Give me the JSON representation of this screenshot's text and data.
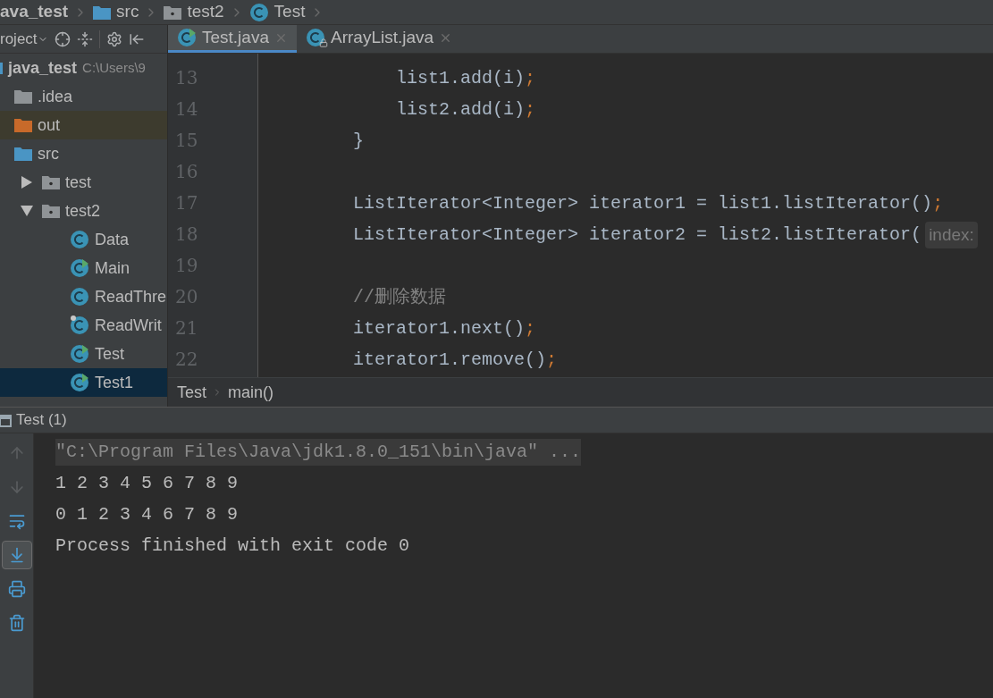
{
  "navigation_bar": [
    {
      "kind": "module",
      "label": "ava_test"
    },
    {
      "kind": "folder",
      "label": "src"
    },
    {
      "kind": "package",
      "label": "test2"
    },
    {
      "kind": "class",
      "label": "Test"
    }
  ],
  "project_toolbar": {
    "label": "roject"
  },
  "project_tree": [
    {
      "kind": "module",
      "label": "java_test",
      "path": "C:\\Users\\9",
      "selected": false,
      "children": [
        {
          "kind": "folder",
          "label": ".idea",
          "color": "#8f9396",
          "excluded": false,
          "selected": false
        },
        {
          "kind": "folder",
          "label": "out",
          "color": "#c86a2a",
          "excluded": true,
          "selected": false
        },
        {
          "kind": "folder",
          "label": "src",
          "color": "#4a95c4",
          "excluded": false,
          "selected": false,
          "children": [
            {
              "kind": "package",
              "label": "test",
              "expanded": false,
              "selected": false
            },
            {
              "kind": "package",
              "label": "test2",
              "expanded": true,
              "selected": false,
              "children": [
                {
                  "kind": "class",
                  "label": "Data",
                  "selected": false
                },
                {
                  "kind": "main_class",
                  "label": "Main",
                  "selected": false
                },
                {
                  "kind": "class",
                  "label": "ReadThre",
                  "selected": false
                },
                {
                  "kind": "marked_class",
                  "label": "ReadWrit",
                  "selected": false
                },
                {
                  "kind": "main_class",
                  "label": "Test",
                  "selected": false
                },
                {
                  "kind": "main_class",
                  "label": "Test1",
                  "selected": true
                }
              ]
            }
          ]
        }
      ]
    }
  ],
  "editor_tabs": [
    {
      "label": "Test.java",
      "selected": true
    },
    {
      "label": "ArrayList.java",
      "selected": false
    }
  ],
  "code_lines": [
    {
      "number": "13",
      "segments": [
        {
          "kind": "code",
          "text": "            list1.add(i)"
        },
        {
          "kind": "keyword",
          "text": ";"
        }
      ]
    },
    {
      "number": "14",
      "segments": [
        {
          "kind": "code",
          "text": "            list2.add(i)"
        },
        {
          "kind": "keyword",
          "text": ";"
        }
      ]
    },
    {
      "number": "15",
      "segments": [
        {
          "kind": "code",
          "text": "        }"
        }
      ]
    },
    {
      "number": "16"
    },
    {
      "number": "17",
      "segments": [
        {
          "kind": "code",
          "text": "        ListIterator<Integer> iterator1 = list1.listIterator()"
        },
        {
          "kind": "keyword",
          "text": ";"
        }
      ]
    },
    {
      "number": "18",
      "segments": [
        {
          "kind": "code",
          "text": "        ListIterator<Integer> iterator2 = list2.listIterator("
        },
        {
          "kind": "hint",
          "text": "index:"
        }
      ]
    },
    {
      "number": "19"
    },
    {
      "number": "20",
      "segments": [
        {
          "kind": "comment",
          "text": "//删除数据"
        }
      ]
    },
    {
      "number": "21",
      "segments": [
        {
          "kind": "code",
          "text": "        iterator1.next()"
        },
        {
          "kind": "keyword",
          "text": ";"
        }
      ]
    },
    {
      "number": "22",
      "segments": [
        {
          "kind": "code",
          "text": "        iterator1.remove()"
        },
        {
          "kind": "keyword",
          "text": ";"
        }
      ]
    }
  ],
  "editor_breadcrumb": [
    "Test",
    "main()"
  ],
  "run_panel": {
    "title": "Test (1)",
    "tools": [
      {
        "kind": "up",
        "disabled": true,
        "selected": false
      },
      {
        "kind": "down",
        "disabled": true,
        "selected": false
      },
      {
        "kind": "wrap",
        "disabled": false,
        "selected": false
      },
      {
        "kind": "scroll",
        "disabled": false,
        "selected": true
      },
      {
        "kind": "print",
        "disabled": false,
        "selected": false
      },
      {
        "kind": "trash",
        "disabled": false,
        "selected": false
      }
    ],
    "console_lines": [
      {
        "kind": "command",
        "text": "\"C:\\Program Files\\Java\\jdk1.8.0_151\\bin\\java\" ..."
      },
      {
        "kind": "output",
        "text": "1 2 3 4 5 6 7 8 9"
      },
      {
        "kind": "output",
        "text": "0 1 2 3 4 6 7 8 9"
      },
      {
        "kind": "output",
        "text": "Process finished with exit code 0"
      }
    ]
  }
}
